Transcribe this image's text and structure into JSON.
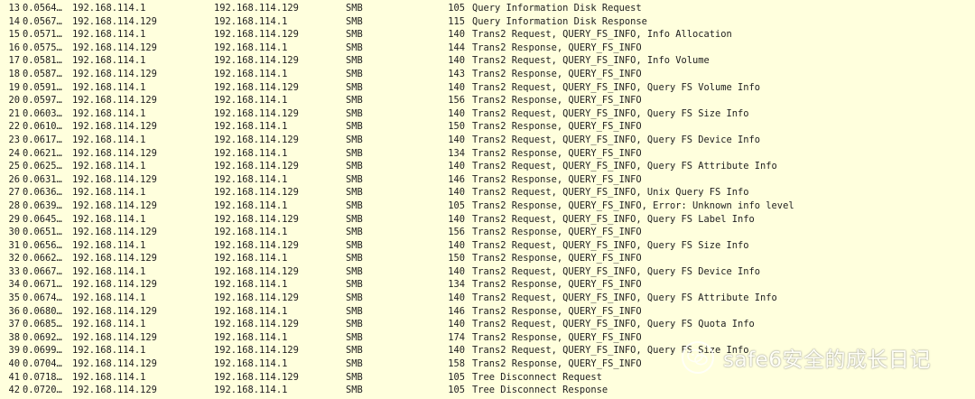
{
  "colors": {
    "row_background": "#ffffdd",
    "text": "#1e1e1e"
  },
  "packets": [
    {
      "no": "13",
      "time": "0.0564…",
      "source": "192.168.114.1",
      "destination": "192.168.114.129",
      "protocol": "SMB",
      "length": "105",
      "info": "Query Information Disk Request"
    },
    {
      "no": "14",
      "time": "0.0567…",
      "source": "192.168.114.129",
      "destination": "192.168.114.1",
      "protocol": "SMB",
      "length": "115",
      "info": "Query Information Disk Response"
    },
    {
      "no": "15",
      "time": "0.0571…",
      "source": "192.168.114.1",
      "destination": "192.168.114.129",
      "protocol": "SMB",
      "length": "140",
      "info": "Trans2 Request, QUERY_FS_INFO, Info Allocation"
    },
    {
      "no": "16",
      "time": "0.0575…",
      "source": "192.168.114.129",
      "destination": "192.168.114.1",
      "protocol": "SMB",
      "length": "144",
      "info": "Trans2 Response, QUERY_FS_INFO"
    },
    {
      "no": "17",
      "time": "0.0581…",
      "source": "192.168.114.1",
      "destination": "192.168.114.129",
      "protocol": "SMB",
      "length": "140",
      "info": "Trans2 Request, QUERY_FS_INFO, Info Volume"
    },
    {
      "no": "18",
      "time": "0.0587…",
      "source": "192.168.114.129",
      "destination": "192.168.114.1",
      "protocol": "SMB",
      "length": "143",
      "info": "Trans2 Response, QUERY_FS_INFO"
    },
    {
      "no": "19",
      "time": "0.0591…",
      "source": "192.168.114.1",
      "destination": "192.168.114.129",
      "protocol": "SMB",
      "length": "140",
      "info": "Trans2 Request, QUERY_FS_INFO, Query FS Volume Info"
    },
    {
      "no": "20",
      "time": "0.0597…",
      "source": "192.168.114.129",
      "destination": "192.168.114.1",
      "protocol": "SMB",
      "length": "156",
      "info": "Trans2 Response, QUERY_FS_INFO"
    },
    {
      "no": "21",
      "time": "0.0603…",
      "source": "192.168.114.1",
      "destination": "192.168.114.129",
      "protocol": "SMB",
      "length": "140",
      "info": "Trans2 Request, QUERY_FS_INFO, Query FS Size Info"
    },
    {
      "no": "22",
      "time": "0.0610…",
      "source": "192.168.114.129",
      "destination": "192.168.114.1",
      "protocol": "SMB",
      "length": "150",
      "info": "Trans2 Response, QUERY_FS_INFO"
    },
    {
      "no": "23",
      "time": "0.0617…",
      "source": "192.168.114.1",
      "destination": "192.168.114.129",
      "protocol": "SMB",
      "length": "140",
      "info": "Trans2 Request, QUERY_FS_INFO, Query FS Device Info"
    },
    {
      "no": "24",
      "time": "0.0621…",
      "source": "192.168.114.129",
      "destination": "192.168.114.1",
      "protocol": "SMB",
      "length": "134",
      "info": "Trans2 Response, QUERY_FS_INFO"
    },
    {
      "no": "25",
      "time": "0.0625…",
      "source": "192.168.114.1",
      "destination": "192.168.114.129",
      "protocol": "SMB",
      "length": "140",
      "info": "Trans2 Request, QUERY_FS_INFO, Query FS Attribute Info"
    },
    {
      "no": "26",
      "time": "0.0631…",
      "source": "192.168.114.129",
      "destination": "192.168.114.1",
      "protocol": "SMB",
      "length": "146",
      "info": "Trans2 Response, QUERY_FS_INFO"
    },
    {
      "no": "27",
      "time": "0.0636…",
      "source": "192.168.114.1",
      "destination": "192.168.114.129",
      "protocol": "SMB",
      "length": "140",
      "info": "Trans2 Request, QUERY_FS_INFO, Unix Query FS Info"
    },
    {
      "no": "28",
      "time": "0.0639…",
      "source": "192.168.114.129",
      "destination": "192.168.114.1",
      "protocol": "SMB",
      "length": "105",
      "info": "Trans2 Response, QUERY_FS_INFO, Error: Unknown info level"
    },
    {
      "no": "29",
      "time": "0.0645…",
      "source": "192.168.114.1",
      "destination": "192.168.114.129",
      "protocol": "SMB",
      "length": "140",
      "info": "Trans2 Request, QUERY_FS_INFO, Query FS Label Info"
    },
    {
      "no": "30",
      "time": "0.0651…",
      "source": "192.168.114.129",
      "destination": "192.168.114.1",
      "protocol": "SMB",
      "length": "156",
      "info": "Trans2 Response, QUERY_FS_INFO"
    },
    {
      "no": "31",
      "time": "0.0656…",
      "source": "192.168.114.1",
      "destination": "192.168.114.129",
      "protocol": "SMB",
      "length": "140",
      "info": "Trans2 Request, QUERY_FS_INFO, Query FS Size Info"
    },
    {
      "no": "32",
      "time": "0.0662…",
      "source": "192.168.114.129",
      "destination": "192.168.114.1",
      "protocol": "SMB",
      "length": "150",
      "info": "Trans2 Response, QUERY_FS_INFO"
    },
    {
      "no": "33",
      "time": "0.0667…",
      "source": "192.168.114.1",
      "destination": "192.168.114.129",
      "protocol": "SMB",
      "length": "140",
      "info": "Trans2 Request, QUERY_FS_INFO, Query FS Device Info"
    },
    {
      "no": "34",
      "time": "0.0671…",
      "source": "192.168.114.129",
      "destination": "192.168.114.1",
      "protocol": "SMB",
      "length": "134",
      "info": "Trans2 Response, QUERY_FS_INFO"
    },
    {
      "no": "35",
      "time": "0.0674…",
      "source": "192.168.114.1",
      "destination": "192.168.114.129",
      "protocol": "SMB",
      "length": "140",
      "info": "Trans2 Request, QUERY_FS_INFO, Query FS Attribute Info"
    },
    {
      "no": "36",
      "time": "0.0680…",
      "source": "192.168.114.129",
      "destination": "192.168.114.1",
      "protocol": "SMB",
      "length": "146",
      "info": "Trans2 Response, QUERY_FS_INFO"
    },
    {
      "no": "37",
      "time": "0.0685…",
      "source": "192.168.114.1",
      "destination": "192.168.114.129",
      "protocol": "SMB",
      "length": "140",
      "info": "Trans2 Request, QUERY_FS_INFO, Query FS Quota Info"
    },
    {
      "no": "38",
      "time": "0.0692…",
      "source": "192.168.114.129",
      "destination": "192.168.114.1",
      "protocol": "SMB",
      "length": "174",
      "info": "Trans2 Response, QUERY_FS_INFO"
    },
    {
      "no": "39",
      "time": "0.0699…",
      "source": "192.168.114.1",
      "destination": "192.168.114.129",
      "protocol": "SMB",
      "length": "140",
      "info": "Trans2 Request, QUERY_FS_INFO, Query FS Size Info"
    },
    {
      "no": "40",
      "time": "0.0704…",
      "source": "192.168.114.129",
      "destination": "192.168.114.1",
      "protocol": "SMB",
      "length": "158",
      "info": "Trans2 Response, QUERY_FS_INFO"
    },
    {
      "no": "41",
      "time": "0.0718…",
      "source": "192.168.114.1",
      "destination": "192.168.114.129",
      "protocol": "SMB",
      "length": "105",
      "info": "Tree Disconnect Request"
    },
    {
      "no": "42",
      "time": "0.0720…",
      "source": "192.168.114.129",
      "destination": "192.168.114.1",
      "protocol": "SMB",
      "length": "105",
      "info": "Tree Disconnect Response"
    }
  ],
  "watermark": {
    "icon": "wechat-icon",
    "text": "safe6安全的成长日记"
  }
}
